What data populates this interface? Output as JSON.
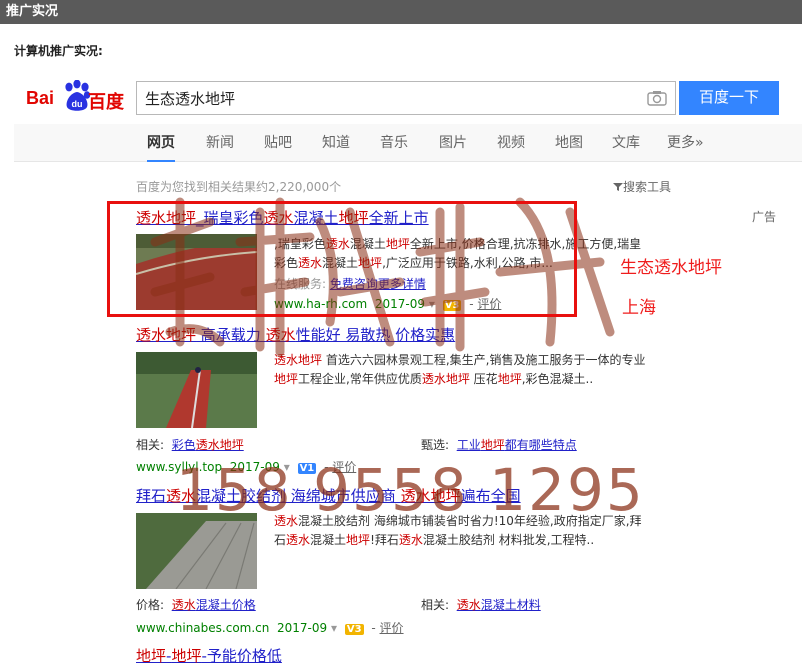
{
  "header": {
    "title": "推广实况",
    "subtitle": "计算机推广实况:"
  },
  "logo": {
    "text_left": "Bai",
    "text_paw": "du",
    "text_right": "百度"
  },
  "search": {
    "query": "生态透水地坪",
    "button": "百度一下"
  },
  "tabs": [
    "网页",
    "新闻",
    "贴吧",
    "知道",
    "音乐",
    "图片",
    "视频",
    "地图",
    "文库",
    "更多»"
  ],
  "stats": "百度为您找到相关结果约2,220,000个",
  "tools": "搜索工具",
  "ad_label": "广告",
  "results": [
    {
      "title": "透水地坪_瑞皇彩色透水混凝土地坪全新上市",
      "desc1": ",瑞皇彩色透水混凝土地坪全新上市,价格合理,抗冻排水,施工方便,瑞皇",
      "desc2": "彩色透水混凝土地坪,广泛应用于铁路,水利,公路,市...",
      "service_label": "在线服务:",
      "service_link": "免费咨询更多详情",
      "url": "www.ha-rh.com",
      "date": "2017-09",
      "badge": "V3",
      "rate": "评价"
    },
    {
      "title": "透水地坪 高承载力 透水性能好 易散热 价格实惠",
      "desc1": "透水地坪 首选六六园林景观工程,集生产,销售及施工服务于一体的专业",
      "desc2": "地坪工程企业,常年供应优质透水地坪 压花地坪,彩色混凝土..",
      "rel_label": "相关:",
      "rel_link": "彩色透水地坪",
      "sel_label": "甄选:",
      "sel_link": "工业地坪都有哪些特点",
      "url": "www.syllyl.top",
      "date": "2017-09",
      "badge": "V1",
      "rate": "评价"
    },
    {
      "title": "拜石透水混凝土胶结剂 海绵城市供应商 透水地坪遍布全国",
      "desc1": "透水混凝土胶结剂 海绵城市铺装省时省力!10年经验,政府指定厂家,拜",
      "desc2": "石透水混凝土地坪!拜石透水混凝土胶结剂 材料批发,工程特..",
      "price_label": "价格:",
      "price_link": "透水混凝土价格",
      "rel_label": "相关:",
      "rel_link": "透水混凝土材料",
      "url": "www.chinabes.com.cn",
      "date": "2017-09",
      "badge": "V3",
      "rate": "评价"
    },
    {
      "title": "地坪-地坪-予能价格低"
    }
  ],
  "watermark": {
    "line1": "生态透水地坪",
    "line2": "上海",
    "phone": "158 9558 1295"
  },
  "colors": {
    "link": "#2121c9",
    "highlight": "#cc0000",
    "url_green": "#008000",
    "brand_red": "#e10602",
    "button_blue": "#3385ff",
    "annotation_red": "#e8100e"
  }
}
